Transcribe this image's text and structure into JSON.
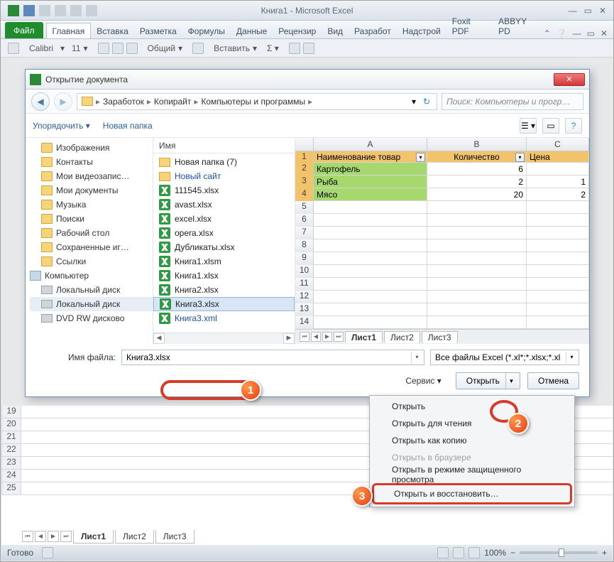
{
  "window": {
    "title": "Книга1 - Microsoft Excel"
  },
  "ribbon": {
    "file": "Файл",
    "tabs": [
      "Главная",
      "Вставка",
      "Разметка",
      "Формулы",
      "Данные",
      "Рецензир",
      "Вид",
      "Разработ",
      "Надстрой",
      "Foxit PDF",
      "ABBYY PD"
    ],
    "font": "Calibri",
    "size": "11",
    "numfmt": "Общий",
    "insert": "Вставить"
  },
  "dialog": {
    "title": "Открытие документа",
    "breadcrumb": [
      "Заработок",
      "Копирайт",
      "Компьютеры и программы"
    ],
    "search_placeholder": "Поиск: Компьютеры и прогр…",
    "toolbar": {
      "organize": "Упорядочить",
      "newfolder": "Новая папка"
    },
    "tree": [
      "Изображения",
      "Контакты",
      "Мои видеозапис…",
      "Мои документы",
      "Музыка",
      "Поиски",
      "Рабочий стол",
      "Сохраненные иг…",
      "Ссылки",
      "Компьютер",
      "Локальный диск",
      "Локальный диск",
      "DVD RW дисково"
    ],
    "filelist": {
      "col": "Имя",
      "items": [
        {
          "t": "folder",
          "n": "Новая папка (7)"
        },
        {
          "t": "folder",
          "n": "Новый сайт",
          "link": true
        },
        {
          "t": "xlsx",
          "n": "111545.xlsx"
        },
        {
          "t": "xlsx",
          "n": "avast.xlsx"
        },
        {
          "t": "xlsx",
          "n": "excel.xlsx"
        },
        {
          "t": "xlsx",
          "n": "opera.xlsx"
        },
        {
          "t": "xlsx",
          "n": "Дубликаты.xlsx"
        },
        {
          "t": "xlsm",
          "n": "Книга1.xlsm"
        },
        {
          "t": "xlsx",
          "n": "Книга1.xlsx"
        },
        {
          "t": "xlsx",
          "n": "Книга2.xlsx"
        },
        {
          "t": "xlsx",
          "n": "Книга3.xlsx",
          "sel": true
        },
        {
          "t": "xml",
          "n": "Книга3.xml",
          "link": true
        }
      ]
    },
    "preview": {
      "cols": [
        "A",
        "B",
        "C"
      ],
      "headers": [
        "Наименование товар",
        "Количество",
        "Цена"
      ],
      "rows": [
        {
          "r": "2",
          "cells": [
            "Картофель",
            "6",
            ""
          ]
        },
        {
          "r": "3",
          "cells": [
            "Рыба",
            "2",
            "1"
          ]
        },
        {
          "r": "4",
          "cells": [
            "Мясо",
            "20",
            "2"
          ]
        }
      ],
      "sheets": [
        "Лист1",
        "Лист2",
        "Лист3"
      ]
    },
    "filename_label": "Имя файла:",
    "filename_value": "Книга3.xlsx",
    "filter": "Все файлы Excel (*.xl*;*.xlsx;*.xl",
    "service": "Сервис",
    "open": "Открыть",
    "cancel": "Отмена",
    "menu": [
      {
        "t": "Открыть"
      },
      {
        "t": "Открыть для чтения"
      },
      {
        "t": "Открыть как копию"
      },
      {
        "t": "Открыть в браузере",
        "disabled": true
      },
      {
        "t": "Открыть в режиме защищенного просмотра"
      },
      {
        "t": "Открыть и восстановить…",
        "hover": true
      }
    ]
  },
  "bottom_rows": [
    "19",
    "20",
    "21",
    "22",
    "23",
    "24",
    "25"
  ],
  "sheet_tabs": [
    "Лист1",
    "Лист2",
    "Лист3"
  ],
  "status": {
    "ready": "Готово",
    "zoom": "100%"
  }
}
